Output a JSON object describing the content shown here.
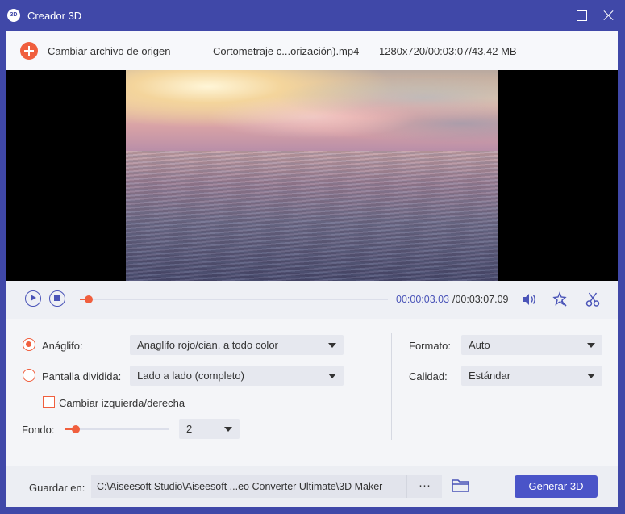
{
  "window": {
    "app_icon_text": "3D",
    "title": "Creador 3D"
  },
  "source": {
    "change_label": "Cambiar archivo de origen",
    "file_name": "Cortometraje c...orización).mp4",
    "file_meta": "1280x720/00:03:07/43,42 MB"
  },
  "player": {
    "current_time": "00:00:03.03",
    "total_time": "/00:03:07.09",
    "progress_fraction": 0.03
  },
  "settings": {
    "anaglyph": {
      "label": "Anáglifo:",
      "checked": true,
      "value": "Anaglifo rojo/cian, a todo color"
    },
    "split": {
      "label": "Pantalla dividida:",
      "checked": false,
      "value": "Lado a lado (completo)"
    },
    "swap": {
      "label": "Cambiar izquierda/derecha",
      "checked": false
    },
    "background": {
      "label": "Fondo:",
      "slider_fraction": 0.1,
      "value": "2"
    },
    "format": {
      "label": "Formato:",
      "value": "Auto"
    },
    "quality": {
      "label": "Calidad:",
      "value": "Estándar"
    }
  },
  "footer": {
    "save_label": "Guardar en:",
    "path": "C:\\Aiseesoft Studio\\Aiseesoft ...eo Converter Ultimate\\3D Maker",
    "browse_label": "···",
    "generate_label": "Generar 3D"
  },
  "colors": {
    "accent": "#f05f3e",
    "brand": "#4048a8",
    "button": "#4a54c8"
  }
}
